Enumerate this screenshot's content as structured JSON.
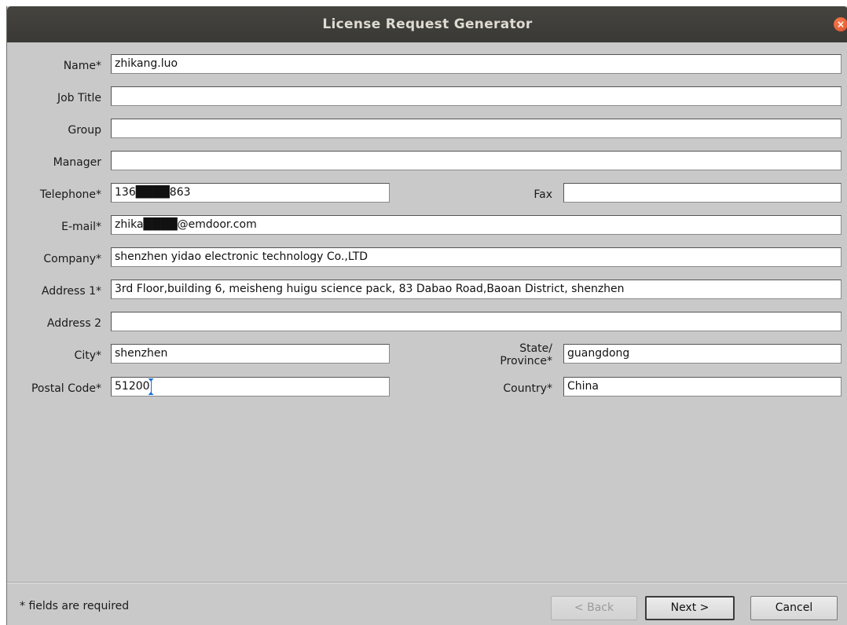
{
  "window": {
    "title": "License Request Generator"
  },
  "form": {
    "name": {
      "label": "Name*",
      "value": "zhikang.luo"
    },
    "job_title": {
      "label": "Job Title",
      "value": ""
    },
    "group": {
      "label": "Group",
      "value": ""
    },
    "manager": {
      "label": "Manager",
      "value": ""
    },
    "telephone": {
      "label": "Telephone*",
      "value": "136████863"
    },
    "fax": {
      "label": "Fax",
      "value": ""
    },
    "email": {
      "label": "E-mail*",
      "value": "zhika████@emdoor.com"
    },
    "company": {
      "label": "Company*",
      "value": "shenzhen yidao electronic technology Co.,LTD"
    },
    "address1": {
      "label": "Address 1*",
      "value": "3rd Floor,building 6, meisheng huigu science pack, 83 Dabao Road,Baoan District, shenzhen"
    },
    "address2": {
      "label": "Address 2",
      "value": ""
    },
    "city": {
      "label": "City*",
      "value": "shenzhen"
    },
    "state": {
      "label_line1": "State/",
      "label_line2": "Province*",
      "value": "guangdong"
    },
    "postal_code": {
      "label": "Postal Code*",
      "value": "51200"
    },
    "country": {
      "label": "Country*",
      "value": "China"
    }
  },
  "footer": {
    "note": "* fields are required",
    "back_label": "< Back",
    "next_label": "Next >",
    "cancel_label": "Cancel"
  },
  "icons": {
    "close": "close-icon"
  }
}
